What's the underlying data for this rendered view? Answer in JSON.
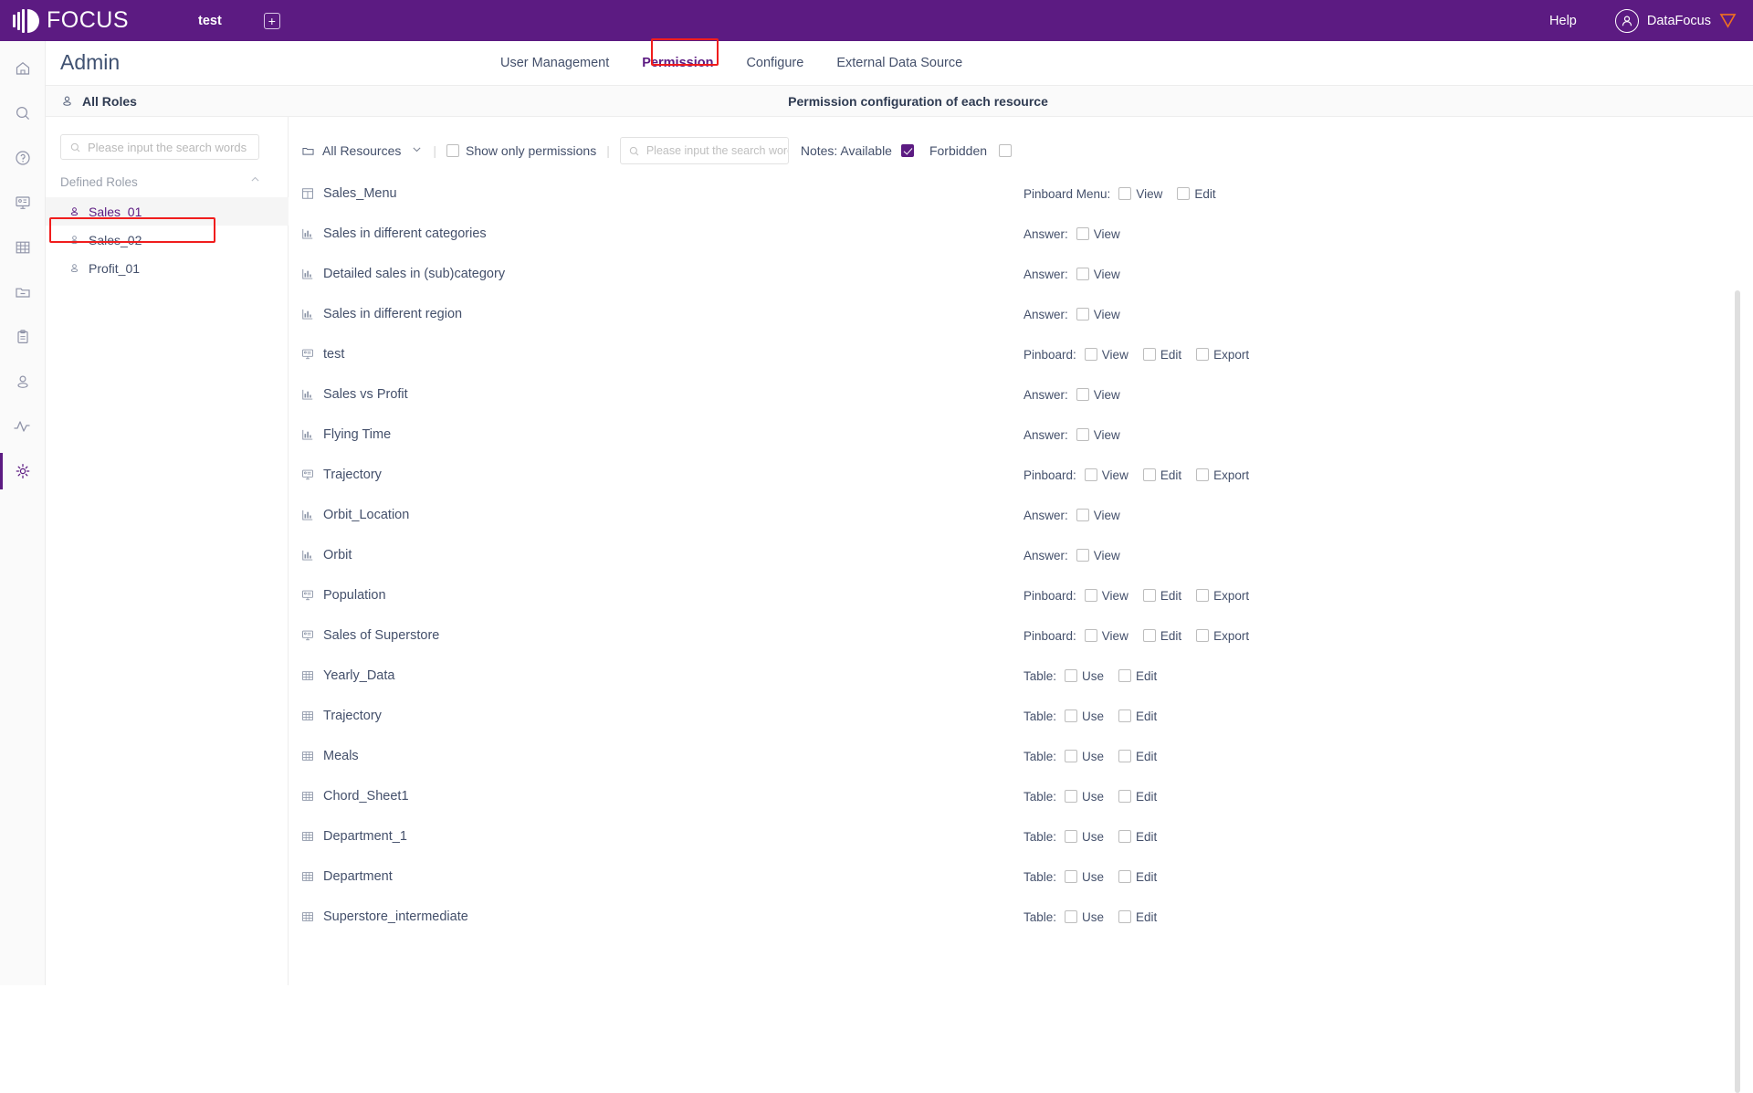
{
  "topbar": {
    "brand": "FOCUS",
    "tab_name": "test",
    "add_tab_icon": "plus-icon",
    "help_label": "Help",
    "user_name": "DataFocus",
    "avatar_icon": "user-avatar-icon",
    "brand_mark_icon": "datafocus-badge-icon",
    "bg_color": "#5c1b82"
  },
  "rail": {
    "items": [
      {
        "name": "home-icon",
        "active": false
      },
      {
        "name": "search-icon",
        "active": false
      },
      {
        "name": "help-circle-icon",
        "active": false
      },
      {
        "name": "pinboard-icon",
        "active": false
      },
      {
        "name": "table-grid-icon",
        "active": false
      },
      {
        "name": "folder-minus-icon",
        "active": false
      },
      {
        "name": "clipboard-icon",
        "active": false
      },
      {
        "name": "user-icon",
        "active": false
      },
      {
        "name": "activity-icon",
        "active": false
      },
      {
        "name": "gear-icon",
        "active": true
      }
    ]
  },
  "page": {
    "title": "Admin",
    "nav_tabs": [
      {
        "label": "User Management",
        "active": false
      },
      {
        "label": "Permission",
        "active": true,
        "highlighted": true
      },
      {
        "label": "Configure",
        "active": false
      },
      {
        "label": "External Data Source",
        "active": false
      }
    ],
    "highlight_color": "#f01d1d"
  },
  "section": {
    "roles_header": "All Roles",
    "roles_header_icon": "user-icon",
    "permission_header": "Permission configuration of each resource"
  },
  "roles_panel": {
    "search_placeholder": "Please input the search words",
    "search_icon": "search-icon",
    "group_label": "Defined Roles",
    "collapse_icon": "chevron-up-icon",
    "roles": [
      {
        "label": "Sales_01",
        "selected": true,
        "highlighted": true,
        "icon": "user-icon"
      },
      {
        "label": "Sales_02",
        "selected": false,
        "highlighted": false,
        "icon": "user-icon"
      },
      {
        "label": "Profit_01",
        "selected": false,
        "highlighted": false,
        "icon": "user-icon"
      }
    ]
  },
  "filter_bar": {
    "resource_select": "All Resources",
    "resource_select_icon": "folder-icon",
    "chevron_icon": "chevron-down-icon",
    "divider": "|",
    "show_only_permissions_label": "Show only permissions",
    "show_only_permissions_checked": false,
    "search_placeholder": "Please input the search words",
    "search_icon": "search-icon",
    "notes_label": "Notes: Available",
    "notes_checked": true,
    "forbidden_label": "Forbidden",
    "forbidden_checked": false
  },
  "resources": [
    {
      "name": "Sales_Menu",
      "icon": "pinboard-menu-icon",
      "perm_label": "Pinboard Menu:",
      "options": [
        {
          "label": "View",
          "checked": false
        },
        {
          "label": "Edit",
          "checked": false
        }
      ]
    },
    {
      "name": "Sales in different categories",
      "icon": "answer-chart-icon",
      "perm_label": "Answer:",
      "options": [
        {
          "label": "View",
          "checked": false
        }
      ]
    },
    {
      "name": "Detailed sales in (sub)category",
      "icon": "answer-chart-icon",
      "perm_label": "Answer:",
      "options": [
        {
          "label": "View",
          "checked": false
        }
      ]
    },
    {
      "name": "Sales in different region",
      "icon": "answer-chart-icon",
      "perm_label": "Answer:",
      "options": [
        {
          "label": "View",
          "checked": false
        }
      ]
    },
    {
      "name": "test",
      "icon": "pinboard-icon",
      "perm_label": "Pinboard:",
      "options": [
        {
          "label": "View",
          "checked": false
        },
        {
          "label": "Edit",
          "checked": false
        },
        {
          "label": "Export",
          "checked": false
        }
      ]
    },
    {
      "name": "Sales vs Profit",
      "icon": "answer-chart-icon",
      "perm_label": "Answer:",
      "options": [
        {
          "label": "View",
          "checked": false
        }
      ]
    },
    {
      "name": "Flying Time",
      "icon": "answer-chart-icon",
      "perm_label": "Answer:",
      "options": [
        {
          "label": "View",
          "checked": false
        }
      ]
    },
    {
      "name": "Trajectory",
      "icon": "pinboard-icon",
      "perm_label": "Pinboard:",
      "options": [
        {
          "label": "View",
          "checked": false
        },
        {
          "label": "Edit",
          "checked": false
        },
        {
          "label": "Export",
          "checked": false
        }
      ]
    },
    {
      "name": "Orbit_Location",
      "icon": "answer-chart-icon",
      "perm_label": "Answer:",
      "options": [
        {
          "label": "View",
          "checked": false
        }
      ]
    },
    {
      "name": "Orbit",
      "icon": "answer-chart-icon",
      "perm_label": "Answer:",
      "options": [
        {
          "label": "View",
          "checked": false
        }
      ]
    },
    {
      "name": "Population",
      "icon": "pinboard-icon",
      "perm_label": "Pinboard:",
      "options": [
        {
          "label": "View",
          "checked": false
        },
        {
          "label": "Edit",
          "checked": false
        },
        {
          "label": "Export",
          "checked": false
        }
      ]
    },
    {
      "name": "Sales of Superstore",
      "icon": "pinboard-icon",
      "perm_label": "Pinboard:",
      "options": [
        {
          "label": "View",
          "checked": false
        },
        {
          "label": "Edit",
          "checked": false
        },
        {
          "label": "Export",
          "checked": false
        }
      ]
    },
    {
      "name": "Yearly_Data",
      "icon": "table-grid-icon",
      "perm_label": "Table:",
      "options": [
        {
          "label": "Use",
          "checked": false
        },
        {
          "label": "Edit",
          "checked": false
        }
      ]
    },
    {
      "name": "Trajectory",
      "icon": "table-grid-icon",
      "perm_label": "Table:",
      "options": [
        {
          "label": "Use",
          "checked": false
        },
        {
          "label": "Edit",
          "checked": false
        }
      ]
    },
    {
      "name": "Meals",
      "icon": "table-grid-icon",
      "perm_label": "Table:",
      "options": [
        {
          "label": "Use",
          "checked": false
        },
        {
          "label": "Edit",
          "checked": false
        }
      ]
    },
    {
      "name": "Chord_Sheet1",
      "icon": "table-grid-icon",
      "perm_label": "Table:",
      "options": [
        {
          "label": "Use",
          "checked": false
        },
        {
          "label": "Edit",
          "checked": false
        }
      ]
    },
    {
      "name": "Department_1",
      "icon": "table-grid-icon",
      "perm_label": "Table:",
      "options": [
        {
          "label": "Use",
          "checked": false
        },
        {
          "label": "Edit",
          "checked": false
        }
      ]
    },
    {
      "name": "Department",
      "icon": "table-grid-icon",
      "perm_label": "Table:",
      "options": [
        {
          "label": "Use",
          "checked": false
        },
        {
          "label": "Edit",
          "checked": false
        }
      ]
    },
    {
      "name": "Superstore_intermediate",
      "icon": "table-grid-icon",
      "perm_label": "Table:",
      "options": [
        {
          "label": "Use",
          "checked": false
        },
        {
          "label": "Edit",
          "checked": false
        }
      ]
    }
  ]
}
